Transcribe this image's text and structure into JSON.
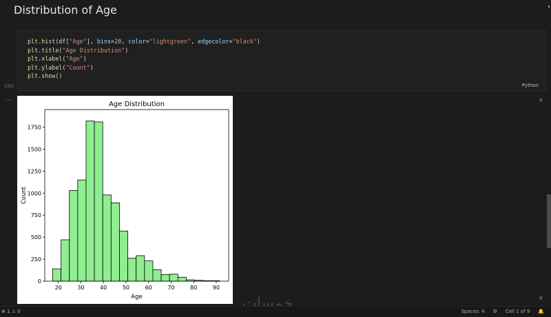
{
  "heading": "Distribution of Age",
  "code": {
    "line1_fn": "plt.hist",
    "line1_open": "(df[",
    "line1_s1": "\"Age\"",
    "line1_mid1": "], ",
    "line1_k1": "bins",
    "line1_eq1": "=",
    "line1_n1": "20",
    "line1_sep1": ", ",
    "line1_k2": "color",
    "line1_eq2": "=",
    "line1_s2": "\"lightgreen\"",
    "line1_sep2": ", ",
    "line1_k3": "edgecolor",
    "line1_eq3": "=",
    "line1_s3": "\"black\"",
    "line1_close": ")",
    "line2_fn": "plt.title",
    "line2_s": "\"Age Distribution\"",
    "line3_fn": "plt.xlabel",
    "line3_s": "\"Age\"",
    "line4_fn": "plt.ylabel",
    "line4_s": "\"Count\"",
    "line5_fn": "plt.show",
    "paren_open": "(",
    "paren_close": ")",
    "empty_call": "()"
  },
  "exec_count": "[33]",
  "language": "Python",
  "output_ellipsis": "...",
  "scroll_up": "▲",
  "scroll_down": "▼",
  "status": {
    "left": "⊗ 1 ⚠ 0",
    "spaces": "Spaces: 4",
    "cell": "Cell 1 of 9"
  },
  "watermark": "خمسات",
  "chart_data": {
    "type": "bar",
    "title": "Age Distribution",
    "xlabel": "Age",
    "ylabel": "Count",
    "bin_edges": [
      17.5,
      21.2,
      24.9,
      28.6,
      32.3,
      36.0,
      39.7,
      43.4,
      47.1,
      50.8,
      54.5,
      58.2,
      61.9,
      65.6,
      69.3,
      73.0,
      76.7,
      80.4,
      84.1,
      87.8,
      91.5
    ],
    "values": [
      140,
      470,
      1030,
      1150,
      1820,
      1810,
      980,
      890,
      570,
      260,
      290,
      230,
      130,
      75,
      80,
      45,
      15,
      10,
      5,
      5
    ],
    "xlim": [
      14,
      95.5
    ],
    "ylim": [
      0,
      1950
    ],
    "xticks": [
      20,
      30,
      40,
      50,
      60,
      70,
      80,
      90
    ],
    "yticks": [
      0,
      250,
      500,
      750,
      1000,
      1250,
      1500,
      1750
    ],
    "bar_color": "#90ee90",
    "edge_color": "#000000",
    "grid": false
  }
}
